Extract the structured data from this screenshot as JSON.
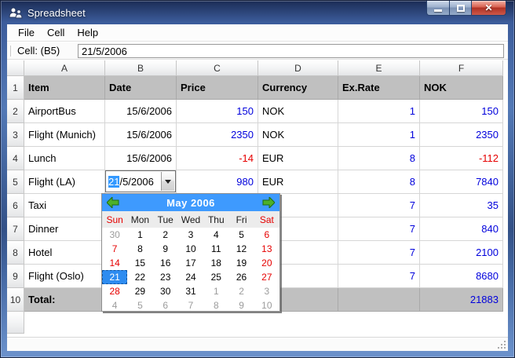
{
  "window": {
    "title": "Spreadsheet"
  },
  "menu": {
    "items": [
      "File",
      "Cell",
      "Help"
    ]
  },
  "toolbar": {
    "label": "Cell: (B5)",
    "value": "21/5/2006"
  },
  "sheet": {
    "column_letters": [
      "A",
      "B",
      "C",
      "D",
      "E",
      "F"
    ],
    "rows": [
      {
        "num": "1",
        "kind": "header",
        "cells": [
          {
            "t": "Item"
          },
          {
            "t": "Date"
          },
          {
            "t": "Price"
          },
          {
            "t": "Currency"
          },
          {
            "t": "Ex.Rate"
          },
          {
            "t": "NOK"
          }
        ]
      },
      {
        "num": "2",
        "cells": [
          {
            "t": "AirportBus"
          },
          {
            "t": "15/6/2006",
            "a": "r"
          },
          {
            "t": "150",
            "a": "r",
            "c": "blue"
          },
          {
            "t": "NOK"
          },
          {
            "t": "1",
            "a": "r",
            "c": "blue"
          },
          {
            "t": "150",
            "a": "r",
            "c": "blue"
          }
        ]
      },
      {
        "num": "3",
        "cells": [
          {
            "t": "Flight (Munich)"
          },
          {
            "t": "15/6/2006",
            "a": "r"
          },
          {
            "t": "2350",
            "a": "r",
            "c": "blue"
          },
          {
            "t": "NOK"
          },
          {
            "t": "1",
            "a": "r",
            "c": "blue"
          },
          {
            "t": "2350",
            "a": "r",
            "c": "blue"
          }
        ]
      },
      {
        "num": "4",
        "cells": [
          {
            "t": "Lunch"
          },
          {
            "t": "15/6/2006",
            "a": "r"
          },
          {
            "t": "-14",
            "a": "r",
            "c": "red"
          },
          {
            "t": "EUR"
          },
          {
            "t": "8",
            "a": "r",
            "c": "blue"
          },
          {
            "t": "-112",
            "a": "r",
            "c": "red"
          }
        ]
      },
      {
        "num": "5",
        "cells": [
          {
            "t": "Flight (LA)"
          },
          {
            "editor": true
          },
          {
            "t": "980",
            "a": "r",
            "c": "blue"
          },
          {
            "t": "EUR"
          },
          {
            "t": "8",
            "a": "r",
            "c": "blue"
          },
          {
            "t": "7840",
            "a": "r",
            "c": "blue"
          }
        ]
      },
      {
        "num": "6",
        "cells": [
          {
            "t": "Taxi"
          },
          {
            "t": ""
          },
          {
            "t": ""
          },
          {
            "t": ""
          },
          {
            "t": "7",
            "a": "r",
            "c": "blue"
          },
          {
            "t": "35",
            "a": "r",
            "c": "blue"
          }
        ]
      },
      {
        "num": "7",
        "cells": [
          {
            "t": "Dinner"
          },
          {
            "t": ""
          },
          {
            "t": ""
          },
          {
            "t": ""
          },
          {
            "t": "7",
            "a": "r",
            "c": "blue"
          },
          {
            "t": "840",
            "a": "r",
            "c": "blue"
          }
        ]
      },
      {
        "num": "8",
        "cells": [
          {
            "t": "Hotel"
          },
          {
            "t": ""
          },
          {
            "t": ""
          },
          {
            "t": ""
          },
          {
            "t": "7",
            "a": "r",
            "c": "blue"
          },
          {
            "t": "2100",
            "a": "r",
            "c": "blue"
          }
        ]
      },
      {
        "num": "9",
        "cells": [
          {
            "t": "Flight (Oslo)"
          },
          {
            "t": ""
          },
          {
            "t": ""
          },
          {
            "t": ""
          },
          {
            "t": "7",
            "a": "r",
            "c": "blue"
          },
          {
            "t": "8680",
            "a": "r",
            "c": "blue"
          }
        ]
      },
      {
        "num": "10",
        "kind": "total",
        "cells": [
          {
            "t": "Total:",
            "b": true
          },
          {
            "t": ""
          },
          {
            "t": ""
          },
          {
            "t": ""
          },
          {
            "t": ""
          },
          {
            "t": "21883",
            "a": "r",
            "c": "blue"
          }
        ]
      }
    ],
    "empty_trailing_row": true
  },
  "editor": {
    "selected": "21",
    "rest": "/5/2006"
  },
  "calendar": {
    "title": "May  2006",
    "day_headers": [
      {
        "t": "Sun",
        "c": "red"
      },
      {
        "t": "Mon"
      },
      {
        "t": "Tue"
      },
      {
        "t": "Wed"
      },
      {
        "t": "Thu"
      },
      {
        "t": "Fri"
      },
      {
        "t": "Sat",
        "c": "red"
      }
    ],
    "selected_day": "21",
    "weeks": [
      [
        {
          "d": "30",
          "k": "out"
        },
        {
          "d": "1"
        },
        {
          "d": "2"
        },
        {
          "d": "3"
        },
        {
          "d": "4"
        },
        {
          "d": "5"
        },
        {
          "d": "6",
          "k": "red"
        }
      ],
      [
        {
          "d": "7",
          "k": "red"
        },
        {
          "d": "8"
        },
        {
          "d": "9"
        },
        {
          "d": "10"
        },
        {
          "d": "11"
        },
        {
          "d": "12"
        },
        {
          "d": "13",
          "k": "red"
        }
      ],
      [
        {
          "d": "14",
          "k": "red"
        },
        {
          "d": "15"
        },
        {
          "d": "16"
        },
        {
          "d": "17"
        },
        {
          "d": "18"
        },
        {
          "d": "19"
        },
        {
          "d": "20",
          "k": "red"
        }
      ],
      [
        {
          "d": "21",
          "k": "sel"
        },
        {
          "d": "22"
        },
        {
          "d": "23"
        },
        {
          "d": "24"
        },
        {
          "d": "25"
        },
        {
          "d": "26"
        },
        {
          "d": "27",
          "k": "red"
        }
      ],
      [
        {
          "d": "28",
          "k": "red"
        },
        {
          "d": "29"
        },
        {
          "d": "30"
        },
        {
          "d": "31"
        },
        {
          "d": "1",
          "k": "out"
        },
        {
          "d": "2",
          "k": "out"
        },
        {
          "d": "3",
          "k": "out"
        }
      ],
      [
        {
          "d": "4",
          "k": "out"
        },
        {
          "d": "5",
          "k": "out"
        },
        {
          "d": "6",
          "k": "out"
        },
        {
          "d": "7",
          "k": "out"
        },
        {
          "d": "8",
          "k": "out"
        },
        {
          "d": "9",
          "k": "out"
        },
        {
          "d": "10",
          "k": "out"
        }
      ]
    ]
  },
  "colors": {
    "accent_blue": "#3e9afe",
    "number_blue": "#0000dc",
    "negative_red": "#e60000",
    "header_gray": "#c0c0c0",
    "selection_blue": "#3399ff",
    "arrow_green": "#4db02a"
  }
}
